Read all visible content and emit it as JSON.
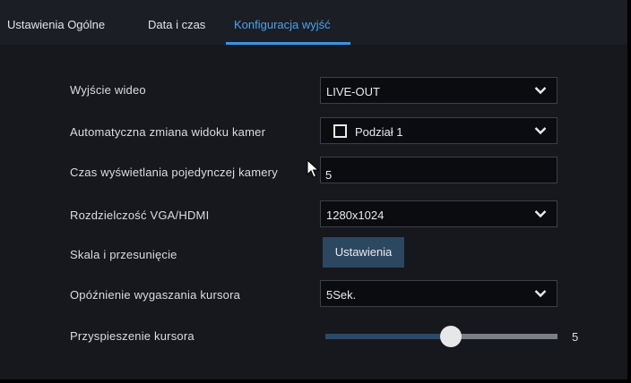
{
  "tabs": [
    {
      "label": "Ustawienia Ogólne",
      "active": false
    },
    {
      "label": "Data i czas",
      "active": false
    },
    {
      "label": "Konfiguracja wyjść",
      "active": true
    }
  ],
  "settings": {
    "video_output": {
      "label": "Wyjście wideo",
      "value": "LIVE-OUT"
    },
    "auto_view_switch": {
      "label": "Automatyczna zmiana widoku kamer",
      "value": "Podział 1",
      "checked": false
    },
    "dwell_time": {
      "label": "Czas wyświetlania pojedynczej kamery",
      "value": "5"
    },
    "resolution": {
      "label": "Rozdzielczość VGA/HDMI",
      "value": "1280x1024"
    },
    "scale_offset": {
      "label": "Skala i przesunięcie",
      "button_label": "Ustawienia"
    },
    "cursor_hide_delay": {
      "label": "Opóźnienie wygaszania kursora",
      "value": "5Sek."
    },
    "cursor_acceleration": {
      "label": "Przyspieszenie kursora",
      "value": "5",
      "level_fraction": 0.54
    }
  },
  "colors": {
    "accent": "#4aa3ef",
    "tab_bar": "#1b1e24",
    "panel": "#16181d",
    "button": "#2c4760",
    "slider_fill": "#2b4a6a"
  },
  "icons": {
    "dropdown": "chevron-down-icon",
    "pointer": "mouse-pointer-icon"
  }
}
